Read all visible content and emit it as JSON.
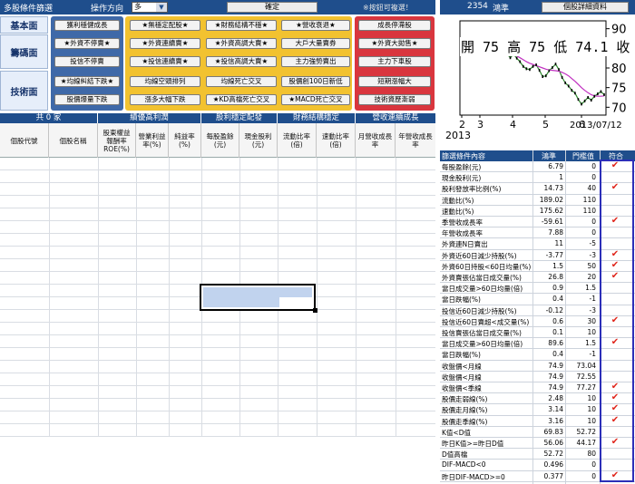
{
  "header": {
    "title": "多股條件篩選",
    "direction_label": "操作方向",
    "direction_value": "多",
    "confirm_label": "確定",
    "option_link": "※按鈕可複選！"
  },
  "sections": {
    "fundamental": "基本面",
    "chip": "籌碼面",
    "technical": "技術面"
  },
  "conditions": {
    "fundamental": [
      "獲利穩健成長",
      "★無穩定配股★",
      "★財務結構不穩★",
      "★營收衰退★",
      "成長停滯股"
    ],
    "chip_row1": [
      "★外資不停賣★",
      "★外資連續賣★",
      "★外資高調大賣★",
      "大戶大量賣券",
      "★外資大拋售★"
    ],
    "chip_row2": [
      "投信不停賣",
      "★投信連續賣★",
      "★投信高調大賣★",
      "主力強勢賣出",
      "主力下車股"
    ],
    "tech_row1": [
      "★均線糾結下跌★",
      "均線空頭排列",
      "均線死亡交叉",
      "股價創100日新低",
      "短期漲幅大"
    ],
    "tech_row2": [
      "股價爆量下跌",
      "漲多大幅下跌",
      "★KD高檔死亡交叉",
      "★MACD死亡交叉",
      "技術資歷漸弱"
    ]
  },
  "table": {
    "count_label": "共 0 家",
    "groups": [
      "績優高利潤",
      "股利穩定配發",
      "財務結構穩定",
      "營收連續成長"
    ],
    "columns": [
      "個股代號",
      "個股名稱",
      "股東權益報酬率ROE(%)",
      "營業利益率(%)",
      "純益率(%)",
      "每股盈餘(元)",
      "現金股利(元)",
      "流動比率(倍)",
      "速動比率(倍)",
      "月營收成長率",
      "年營收成長率"
    ]
  },
  "stock": {
    "code": "2354",
    "name": "鴻準",
    "detail_button": "個股詳細資料",
    "quote": "開 75  高 75  低 74.1  收 75",
    "date_label": "2013/07/12",
    "year_label": "2013",
    "x_ticks": [
      "2",
      "3",
      "4",
      "5",
      "6"
    ],
    "y_ticks": [
      "90",
      "85",
      "80",
      "75",
      "70"
    ]
  },
  "chart_data": {
    "type": "line",
    "title": "",
    "y_range": [
      68,
      92
    ],
    "series": [
      {
        "values": [
          84.5,
          85.2,
          85.0,
          86.3,
          86.0,
          87.3,
          87.0,
          85.6,
          86.3,
          86.0,
          84.5,
          84.8,
          85.3,
          84.6,
          83.6,
          82.6,
          83.5,
          82.5,
          81.6,
          80.4,
          79.8,
          79.6,
          80.4,
          80.8,
          79.4,
          77.8,
          78.0,
          79.3,
          80.1,
          81.0,
          79.6,
          77.6,
          76.2,
          75.4,
          74.3,
          73.6,
          72.0,
          70.8,
          71.6,
          72.5,
          71.8,
          72.8,
          73.4,
          74.0,
          73.2
        ]
      },
      {
        "values": [
          86.0,
          86.1,
          86.2,
          86.3,
          86.4,
          86.4,
          86.4,
          86.3,
          86.2,
          86.0,
          85.7,
          85.4,
          85.1,
          84.8,
          84.4,
          84.0,
          83.6,
          83.1,
          82.6,
          82.1,
          81.6,
          81.2,
          80.9,
          80.6,
          80.3,
          80.0,
          79.7,
          79.5,
          79.4,
          79.3,
          79.2,
          78.9,
          78.5,
          78.0,
          77.3,
          76.6,
          75.8,
          75.0,
          74.3,
          73.7,
          73.2,
          72.9,
          72.8,
          72.8,
          72.9
        ]
      }
    ]
  },
  "criteria": {
    "headers": [
      "篩選條件內容",
      "鴻準",
      "門檻值",
      "符合"
    ],
    "rows": [
      {
        "name": "每股盈餘(元)",
        "value": "6.79",
        "threshold": "0",
        "ok": "✔"
      },
      {
        "name": "現金股利(元)",
        "value": "1",
        "threshold": "0",
        "ok": ""
      },
      {
        "name": "股利發放率比例(%)",
        "value": "14.73",
        "threshold": "40",
        "ok": "✔"
      },
      {
        "name": "流動比(%)",
        "value": "189.02",
        "threshold": "110",
        "ok": ""
      },
      {
        "name": "速動比(%)",
        "value": "175.62",
        "threshold": "110",
        "ok": ""
      },
      {
        "name": "季營收成長率",
        "value": "-59.61",
        "threshold": "0",
        "ok": "✔"
      },
      {
        "name": "年營收成長率",
        "value": "7.88",
        "threshold": "0",
        "ok": ""
      },
      {
        "name": "外資連N日賣出",
        "value": "11",
        "threshold": "-5",
        "ok": ""
      },
      {
        "name": "外資近60日減少持股(%)",
        "value": "-3.77",
        "threshold": "-3",
        "ok": "✔"
      },
      {
        "name": "外資60日持股<60日均量(%)",
        "value": "1.5",
        "threshold": "50",
        "ok": "✔"
      },
      {
        "name": "外資賣張佔當日成交量(%)",
        "value": "26.8",
        "threshold": "20",
        "ok": "✔"
      },
      {
        "name": "當日成交量>60日均量(倍)",
        "value": "0.9",
        "threshold": "1.5",
        "ok": ""
      },
      {
        "name": "當日跌幅(%)",
        "value": "0.4",
        "threshold": "-1",
        "ok": ""
      },
      {
        "name": "投信近60日減少持股(%)",
        "value": "-0.12",
        "threshold": "-3",
        "ok": ""
      },
      {
        "name": "投信近60日賣超<成交量(%)",
        "value": "0.6",
        "threshold": "30",
        "ok": "✔"
      },
      {
        "name": "投信賣張佔當日成交量(%)",
        "value": "0.1",
        "threshold": "10",
        "ok": ""
      },
      {
        "name": "當日成交量>60日均量(倍)",
        "value": "89.6",
        "threshold": "1.5",
        "ok": "✔"
      },
      {
        "name": "當日跌幅(%)",
        "value": "0.4",
        "threshold": "-1",
        "ok": ""
      },
      {
        "name": "收盤價<月線",
        "value": "74.9",
        "threshold": "73.04",
        "ok": ""
      },
      {
        "name": "收盤價<月線",
        "value": "74.9",
        "threshold": "72.55",
        "ok": ""
      },
      {
        "name": "收盤價<季線",
        "value": "74.9",
        "threshold": "77.27",
        "ok": "✔"
      },
      {
        "name": "股價走弱線(%)",
        "value": "2.48",
        "threshold": "10",
        "ok": "✔"
      },
      {
        "name": "股價走月線(%)",
        "value": "3.14",
        "threshold": "10",
        "ok": "✔"
      },
      {
        "name": "股價走季線(%)",
        "value": "3.16",
        "threshold": "10",
        "ok": "✔"
      },
      {
        "name": "K值<D值",
        "value": "69.83",
        "threshold": "52.72",
        "ok": ""
      },
      {
        "name": "昨日K值>=昨日D值",
        "value": "56.06",
        "threshold": "44.17",
        "ok": "✔"
      },
      {
        "name": "D值高檔",
        "value": "52.72",
        "threshold": "80",
        "ok": ""
      },
      {
        "name": "DIF-MACD<0",
        "value": "0.496",
        "threshold": "0",
        "ok": ""
      },
      {
        "name": "昨日DIF-MACD>=0",
        "value": "0.377",
        "threshold": "0",
        "ok": "✔"
      }
    ]
  }
}
